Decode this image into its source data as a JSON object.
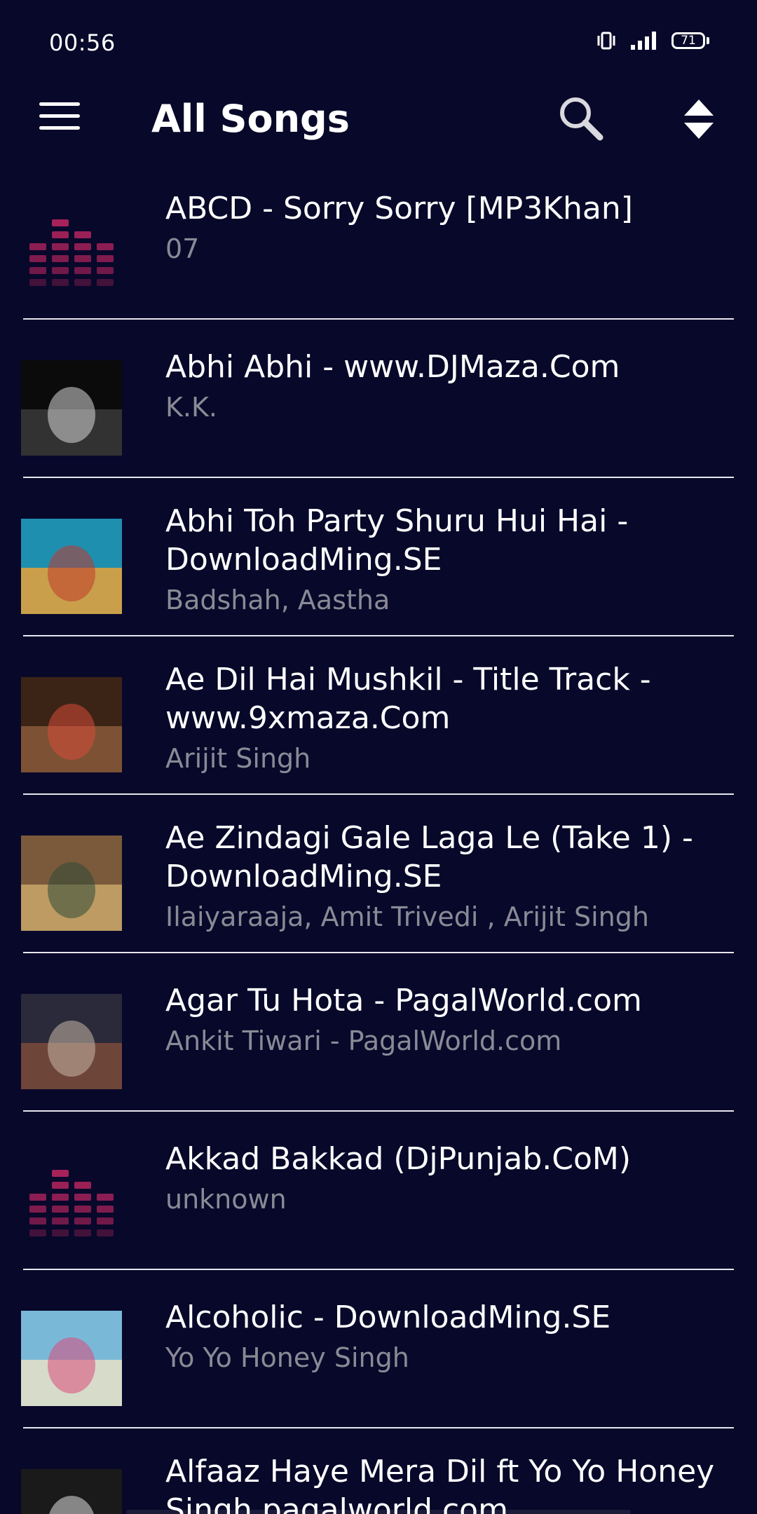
{
  "status_bar": {
    "time": "00:56",
    "battery_level": "71"
  },
  "app_bar": {
    "title": "All Songs",
    "menu_icon": "menu-icon",
    "search_icon": "search-icon",
    "sort_icon": "sort-icon"
  },
  "songs": [
    {
      "title_lines": [
        "ABCD - Sorry Sorry [MP3Khan]"
      ],
      "artist": "07",
      "art": "equalizer-placeholder"
    },
    {
      "title_lines": [
        "Abhi Abhi - www.DJMaza.Com"
      ],
      "artist": "K.K.",
      "art": "album-cover"
    },
    {
      "title_lines": [
        "Abhi Toh Party Shuru Hui Hai -",
        "DownloadMing.SE"
      ],
      "artist": "Badshah, Aastha",
      "art": "album-cover"
    },
    {
      "title_lines": [
        "Ae Dil Hai Mushkil - Title Track -",
        "www.9xmaza.Com"
      ],
      "artist": "Arijit Singh",
      "art": "album-cover"
    },
    {
      "title_lines": [
        "Ae Zindagi Gale Laga Le (Take 1) -",
        "DownloadMing.SE"
      ],
      "artist": "Ilaiyaraaja, Amit Trivedi , Arijit Singh",
      "art": "album-cover"
    },
    {
      "title_lines": [
        "Agar Tu Hota - PagalWorld.com"
      ],
      "artist": "Ankit Tiwari - PagalWorld.com",
      "art": "album-cover"
    },
    {
      "title_lines": [
        "Akkad Bakkad (DjPunjab.CoM)"
      ],
      "artist": "unknown",
      "art": "equalizer-placeholder"
    },
    {
      "title_lines": [
        "Alcoholic - DownloadMing.SE"
      ],
      "artist": "Yo Yo Honey Singh",
      "art": "album-cover"
    },
    {
      "title_lines": [
        "Alfaaz Haye Mera Dil ft Yo Yo Honey",
        "Singh pagalworld.com"
      ],
      "artist": "",
      "art": "album-cover"
    }
  ],
  "colors": {
    "background": "#08082a",
    "title_text": "#ffffff",
    "subtitle_text": "#8a8a96",
    "divider": "#e6e6ee",
    "equalizer": "#b0245c"
  }
}
